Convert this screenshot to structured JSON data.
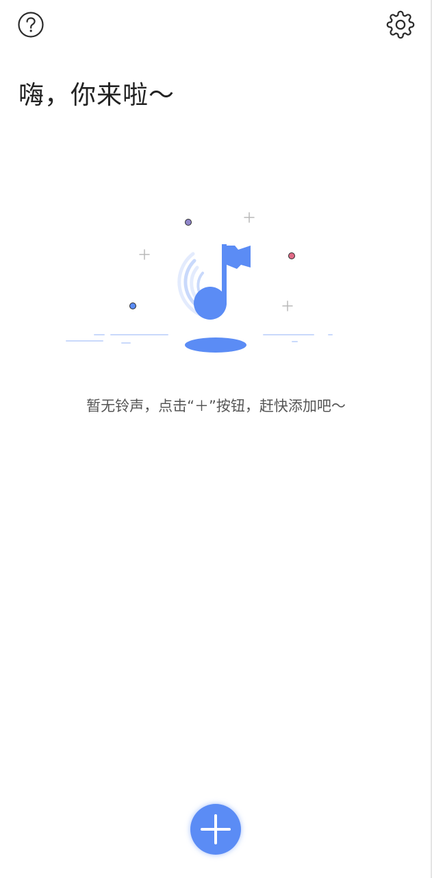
{
  "header": {
    "help_icon": "help-circle-icon",
    "settings_icon": "gear-icon"
  },
  "greeting": "嗨，你来啦～",
  "empty_state": {
    "illustration_icon": "music-note-flag-icon",
    "message": "暂无铃声，点击“＋”按钮，赶快添加吧～"
  },
  "fab": {
    "icon": "plus-icon"
  },
  "colors": {
    "accent": "#5b8cf5",
    "light_accent": "#c9d9fb",
    "dot_purple": "#8f86c9",
    "dot_pink": "#e06a86",
    "dot_blue": "#5b8cf5",
    "text_primary": "#222222",
    "text_secondary": "#555555"
  }
}
